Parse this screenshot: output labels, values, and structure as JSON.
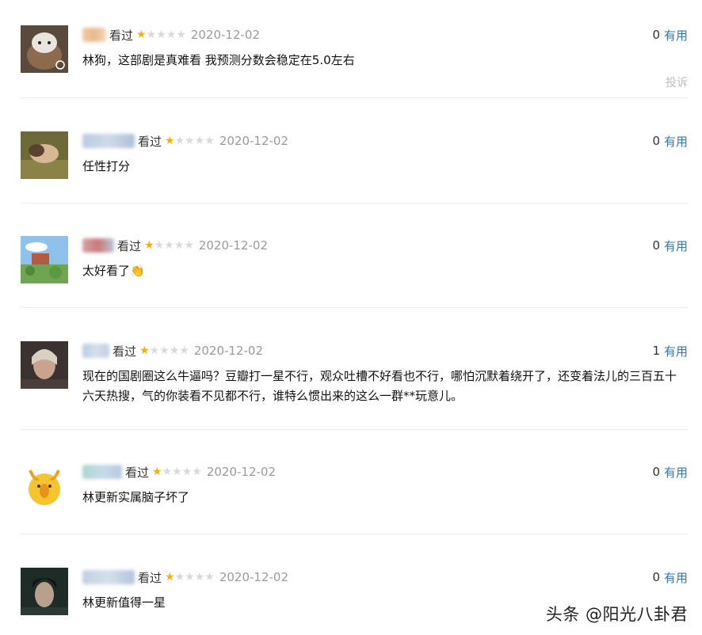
{
  "reviews": [
    {
      "watched": "看过",
      "rating": 1,
      "date": "2020-12-02",
      "useful_count": "0",
      "useful_label": "有用",
      "content": "林狗，这部剧是真难看 我预测分数会稳定在5.0左右",
      "report": "投诉"
    },
    {
      "watched": "看过",
      "rating": 1,
      "date": "2020-12-02",
      "useful_count": "0",
      "useful_label": "有用",
      "content": "任性打分"
    },
    {
      "watched": "看过",
      "rating": 1,
      "date": "2020-12-02",
      "useful_count": "0",
      "useful_label": "有用",
      "content": "太好看了👏"
    },
    {
      "watched": "看过",
      "rating": 1,
      "date": "2020-12-02",
      "useful_count": "1",
      "useful_label": "有用",
      "content": "现在的国剧圈这么牛逼吗？豆瓣打一星不行，观众吐槽不好看也不行，哪怕沉默着绕开了，还变着法儿的三百五十六天热搜，气的你装看不见都不行，谁特么惯出来的这么一群**玩意儿。"
    },
    {
      "watched": "看过",
      "rating": 1,
      "date": "2020-12-02",
      "useful_count": "0",
      "useful_label": "有用",
      "content": "林更新实属脑子坏了"
    },
    {
      "watched": "看过",
      "rating": 1,
      "date": "2020-12-02",
      "useful_count": "0",
      "useful_label": "有用",
      "content": "林更新值得一星"
    }
  ],
  "max_rating": 5,
  "colors": {
    "star_on": "#f3b012",
    "star_off": "#d9d9d9",
    "link": "#3377aa"
  },
  "watermark": "头条 @阳光八卦君"
}
